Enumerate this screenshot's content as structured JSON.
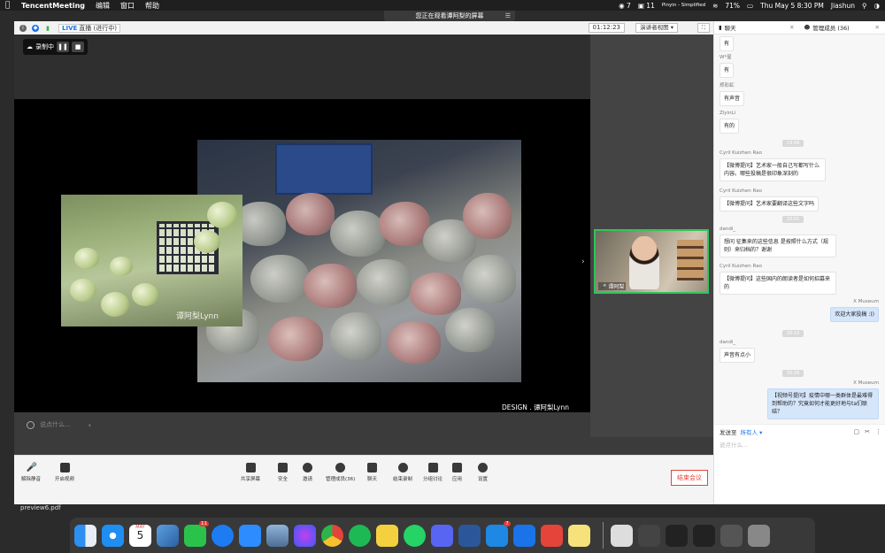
{
  "menubar": {
    "app": "TencentMeeting",
    "items": [
      "编辑",
      "窗口",
      "帮助"
    ],
    "status": {
      "wechat_badge": "7",
      "cal_badge": "11",
      "input_method": "Pinyin - Simplified",
      "battery": "71%",
      "datetime": "Thu May 5  8:30 PM",
      "user": "Jiashun"
    }
  },
  "share_banner": {
    "text": "您正在观看谭阿梨的屏幕"
  },
  "infobar": {
    "live_label": "LIVE",
    "live_status": "直播 (进行中)",
    "timer": "01:12:23",
    "view_mode": "演讲者视图"
  },
  "recording": {
    "label": "录制中"
  },
  "slide": {
    "watermark": "谭阿梨Lynn",
    "design_credit": "DESIGN . 谭阿梨Lynn"
  },
  "stage_chat": {
    "placeholder": "说点什么..."
  },
  "participant": {
    "name": "谭阿梨"
  },
  "toolbar": {
    "mute": "解除静音",
    "video": "开启视频",
    "share": "共享屏幕",
    "security": "安全",
    "invite": "邀请",
    "members": "管理成员(36)",
    "chat": "聊天",
    "end_record": "结束录制",
    "breakout": "分组讨论",
    "apps": "应用",
    "settings": "设置",
    "end_meeting": "结束会议"
  },
  "side": {
    "tab_chat": "聊天",
    "tab_members": "管理成员 (36)",
    "messages": [
      {
        "who": "",
        "text": "有"
      },
      {
        "who": "W*星",
        "text": "有"
      },
      {
        "who": "郑彩虹",
        "text": "有声音"
      },
      {
        "who": "ZiyinLi",
        "text": "有的"
      },
      {
        "ts": "19:46"
      },
      {
        "who": "Cyril Kuizhen Rao",
        "text": "【微博提问】艺术家一般自己写都写什么内容。哪些投稿是很印象深刻的"
      },
      {
        "who": "Cyril Kuizhen Rao",
        "text": "【微博提问】艺术家要翻译这些文字吗"
      },
      {
        "ts": "20:01"
      },
      {
        "who": "dandi_",
        "text": "想问 征集来的这些信息 是按照什么方式（规则）来归档的？谢谢"
      },
      {
        "who": "Cyril Kuizhen Rao",
        "text": "【微博提问】这些国内的朗读者是如何招募来的"
      },
      {
        "me": "X Museum",
        "text": "欢迎大家投稿 :))"
      },
      {
        "ts": "20:10"
      },
      {
        "who": "dandi_",
        "text": "声音有点小"
      },
      {
        "ts": "20:26"
      },
      {
        "me": "X Museum",
        "text": "【视频号提问】疫情中哪一类群体是最难得到帮助的？究竟如何才能更好地与ta们联结？"
      }
    ],
    "send_to_label": "发送至",
    "send_to_value": "所有人",
    "input_placeholder": "说点什么..."
  },
  "desktop": {
    "file": "preview6.pdf",
    "dock_badges": {
      "wechat": "11",
      "mail": "7"
    },
    "calendar_month": "MAY",
    "calendar_day": "5"
  }
}
